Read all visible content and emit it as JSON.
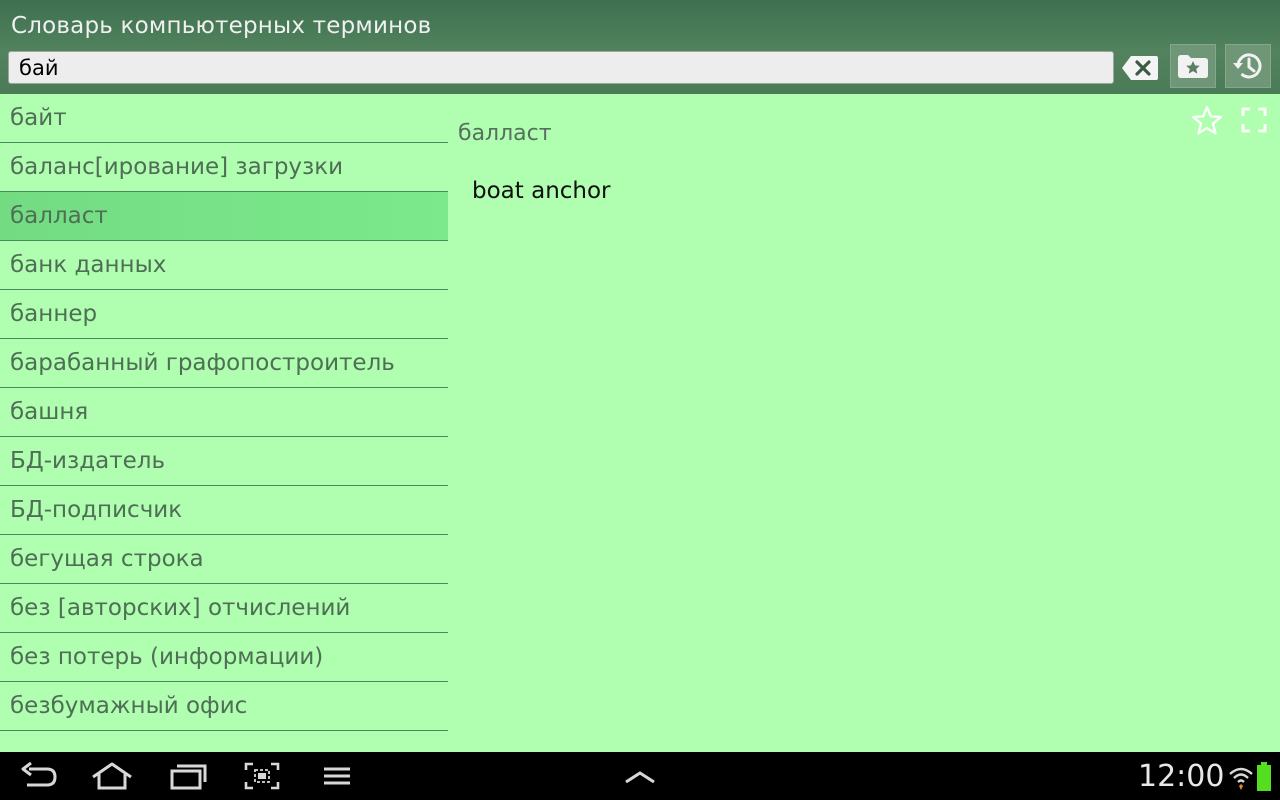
{
  "app": {
    "title": "Словарь компьютерных терминов"
  },
  "search": {
    "value": "бай"
  },
  "word_list": {
    "items": [
      {
        "label": "байт",
        "selected": false
      },
      {
        "label": "баланс[ирование] загрузки",
        "selected": false
      },
      {
        "label": "балласт",
        "selected": true
      },
      {
        "label": "банк данных",
        "selected": false
      },
      {
        "label": "баннер",
        "selected": false
      },
      {
        "label": "барабанный графопостроитель",
        "selected": false
      },
      {
        "label": "башня",
        "selected": false
      },
      {
        "label": "БД-издатель",
        "selected": false
      },
      {
        "label": "БД-подписчик",
        "selected": false
      },
      {
        "label": "бегущая строка",
        "selected": false
      },
      {
        "label": "без [авторских] отчислений",
        "selected": false
      },
      {
        "label": "без потерь (информации)",
        "selected": false
      },
      {
        "label": "безбумажный офис",
        "selected": false
      }
    ]
  },
  "detail": {
    "word": "балласт",
    "translation": "boat anchor"
  },
  "icons": {
    "clear": "backspace-clear-icon",
    "favorites": "favorites-folder-icon",
    "history": "history-icon",
    "star": "star-outline-icon",
    "fullscreen": "fullscreen-icon",
    "back": "back-icon",
    "home": "home-icon",
    "recents": "recent-apps-icon",
    "screenshot": "screenshot-icon",
    "menu": "menu-icon",
    "up": "chevron-up-icon",
    "wifi": "wifi-icon",
    "battery": "battery-icon"
  },
  "colors": {
    "background": "#b0ffb0",
    "selected_row": "#7ce98c",
    "header": "#4a7a56",
    "battery": "#55dd22"
  },
  "status_bar": {
    "time": "12:00"
  }
}
